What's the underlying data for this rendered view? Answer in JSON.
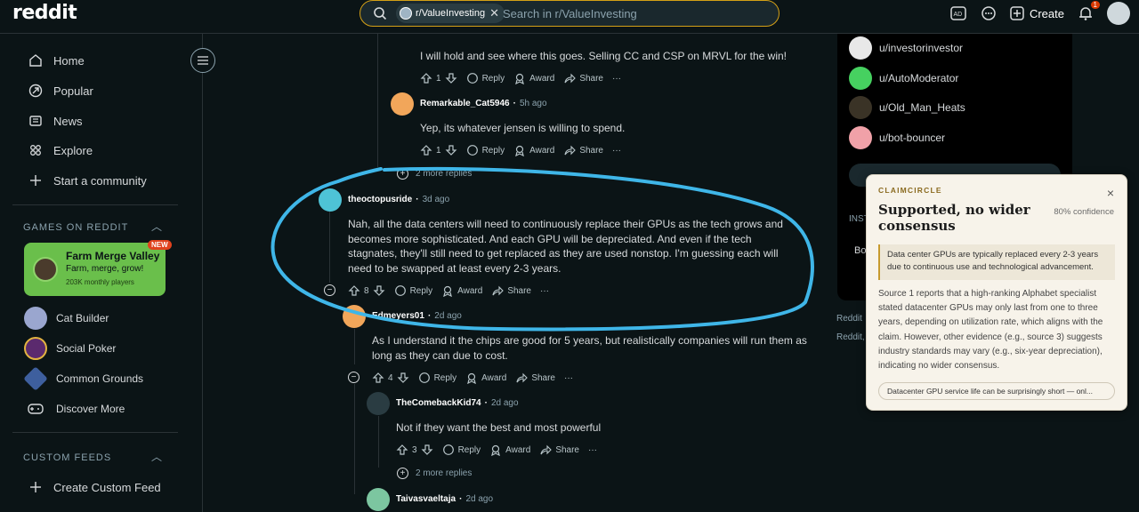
{
  "topbar": {
    "logo": "reddit",
    "search_chip": "r/ValueInvesting",
    "search_placeholder": "Search in r/ValueInvesting",
    "create_label": "Create",
    "notification_count": "1"
  },
  "sidebar": {
    "nav": [
      "Home",
      "Popular",
      "News",
      "Explore",
      "Start a community"
    ],
    "games_title": "GAMES ON REDDIT",
    "featured_game": {
      "title": "Farm Merge Valley",
      "subtitle": "Farm, merge, grow!",
      "meta": "203K monthly players",
      "badge": "NEW"
    },
    "games": [
      "Cat Builder",
      "Social Poker",
      "Common Grounds",
      "Discover More"
    ],
    "custom_feeds_title": "CUSTOM FEEDS",
    "create_feed": "Create Custom Feed"
  },
  "comments": {
    "top_text": "I will hold and see where this goes. Selling CC and CSP on MRVL for the win!",
    "top_votes": "1",
    "c1": {
      "author": "Remarkable_Cat5946",
      "ago": "5h ago",
      "text": "Yep, its whatever jensen is willing to spend.",
      "votes": "1"
    },
    "more_replies_1": "2 more replies",
    "c2": {
      "author": "theoctopusride",
      "ago": "3d ago",
      "text": "Nah, all the data centers will need to continuously replace their GPUs as the tech grows and becomes more sophisticated. And each GPU will be depreciated. And even if the tech stagnates, they'll still need to get replaced as they are used nonstop. I'm guessing each will need to be swapped at least every 2-3 years.",
      "votes": "8"
    },
    "c3": {
      "author": "Edmeyers01",
      "ago": "2d ago",
      "text": "As I understand it the chips are good for 5 years, but realistically companies will run them as long as they can due to cost.",
      "votes": "4"
    },
    "c4": {
      "author": "TheComebackKid74",
      "ago": "2d ago",
      "text": "Not if they want the best and most powerful",
      "votes": "3"
    },
    "more_replies_2": "2 more replies",
    "c5": {
      "author": "Taivasvaeltaja",
      "ago": "2d ago"
    },
    "actions": {
      "reply": "Reply",
      "award": "Award",
      "share": "Share",
      "more": "···"
    }
  },
  "right": {
    "moderators": [
      "u/investorinvestor",
      "u/AutoModerator",
      "u/Old_Man_Heats",
      "u/bot-bouncer"
    ],
    "view_all": "View all moderators",
    "inst": "INST",
    "bo": "Bo",
    "footer1": "Reddit",
    "footer2": "Reddit,"
  },
  "claimcircle": {
    "brand": "CLAIMCIRCLE",
    "title": "Supported, no wider consensus",
    "confidence": "80% confidence",
    "claim": "Data center GPUs are typically replaced every 2-3 years due to continuous use and technological advancement.",
    "body": "Source 1 reports that a high-ranking Alphabet specialist stated datacenter GPUs may only last from one to three years, depending on utilization rate, which aligns with the claim. However, other evidence (e.g., source 3) suggests industry standards may vary (e.g., six-year depreciation), indicating no wider consensus.",
    "source": "Datacenter GPU service life can be surprisingly short — onl..."
  },
  "colors": {
    "bg": "#0b1416",
    "accent_search": "#d4a016",
    "annotation": "#3fb6e8",
    "card_bg": "#f7f3ea"
  }
}
